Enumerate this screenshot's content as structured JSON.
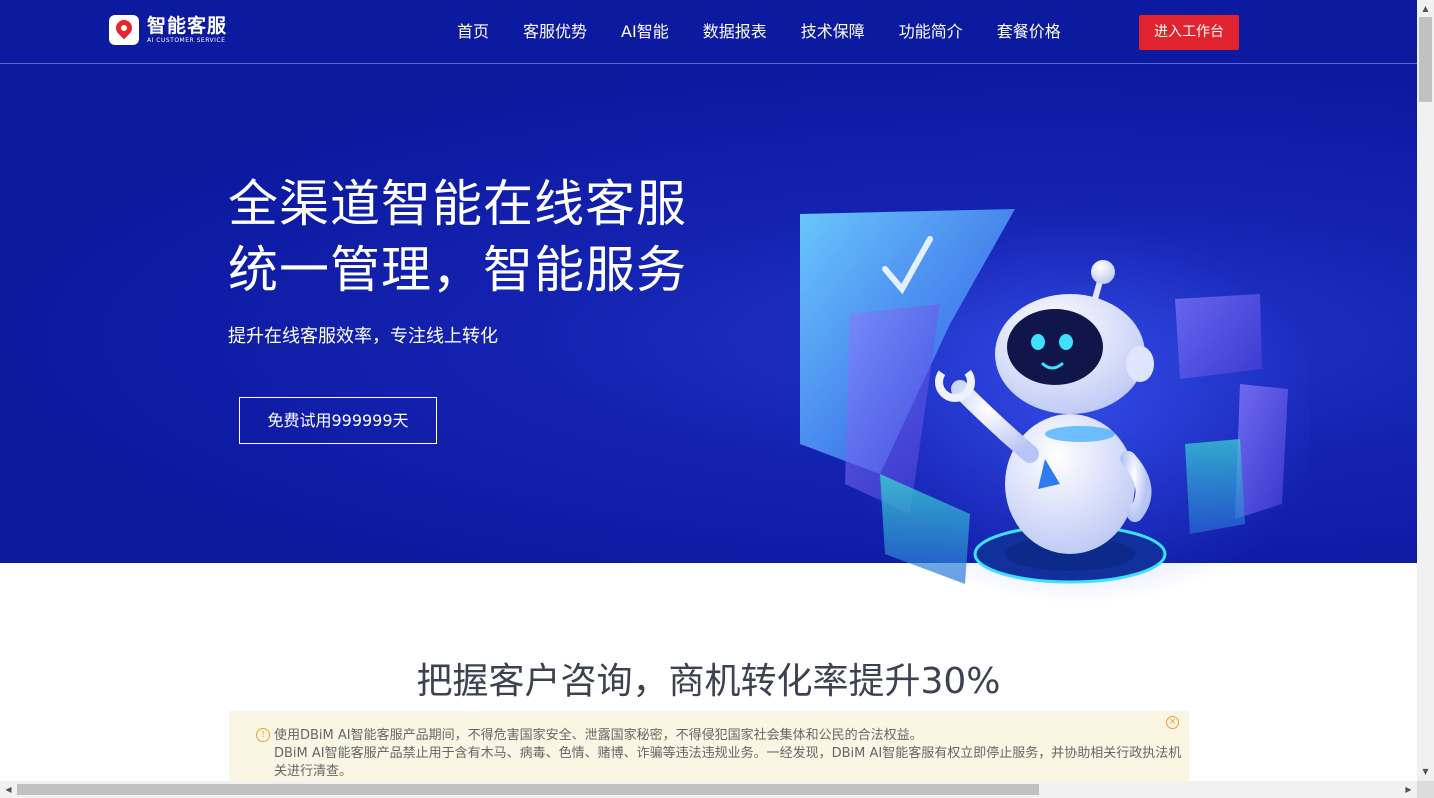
{
  "logo": {
    "name": "智能客服",
    "tagline": "AI CUSTOMER SERVICE"
  },
  "nav": {
    "items": [
      "首页",
      "客服优势",
      "AI智能",
      "数据报表",
      "技术保障",
      "功能简介",
      "套餐价格"
    ],
    "workbench_label": "进入工作台"
  },
  "hero": {
    "title_line1": "全渠道智能在线客服",
    "title_line2": "统一管理，智能服务",
    "subtitle": "提升在线客服效率，专注线上转化",
    "trial_label": "免费试用999999天"
  },
  "section": {
    "title": "把握客户咨询，商机转化率提升30%"
  },
  "notice": {
    "line1": "使用DBiM AI智能客服产品期间，不得危害国家安全、泄露国家秘密，不得侵犯国家社会集体和公民的合法权益。",
    "line2": "DBiM AI智能客服产品禁止用于含有木马、病毒、色情、赌博、诈骗等违法违规业务。一经发现，DBiM AI智能客服有权立即停止服务，并协助相关行政执法机关进行清查。"
  },
  "colors": {
    "header_bg": "#0b1a9e",
    "hero_bg": "#1422b0",
    "accent_red": "#e0232e",
    "notice_bg": "#fbf6e3",
    "warn": "#e6a23c"
  },
  "icons": [
    "logo-pin-icon",
    "warning-icon",
    "close-icon",
    "robot-illustration"
  ]
}
